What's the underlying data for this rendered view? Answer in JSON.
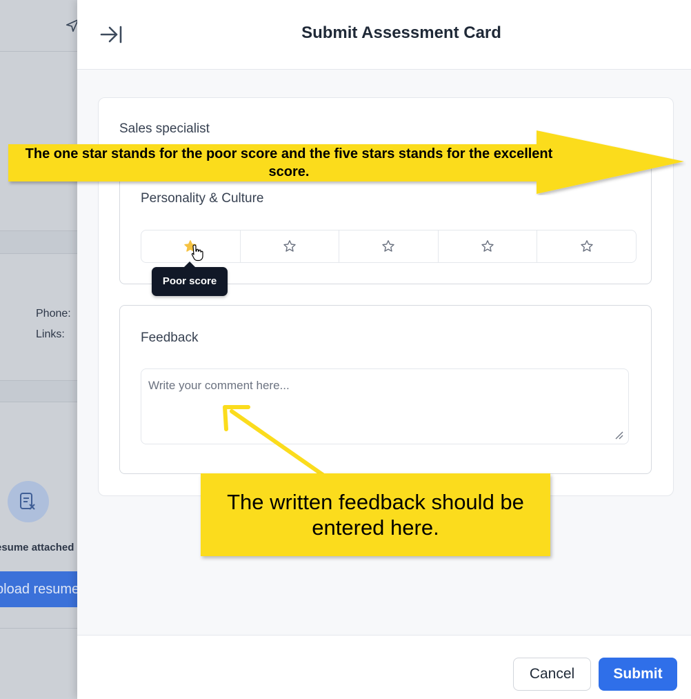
{
  "background": {
    "phone_label": "Phone:",
    "links_label": "Links:",
    "resume_text": "esume attached",
    "upload_button": "pload resume"
  },
  "drawer": {
    "title": "Submit Assessment Card",
    "job_title": "Sales specialist",
    "personality": {
      "label": "Personality & Culture",
      "rating_selected": 1,
      "rating_max": 5,
      "tooltip": "Poor score"
    },
    "feedback": {
      "label": "Feedback",
      "placeholder": "Write your comment here...",
      "value": ""
    },
    "cancel_label": "Cancel",
    "submit_label": "Submit"
  },
  "annotations": {
    "rating_note": "The one star stands for the poor score and the five stars stands for the excellent score.",
    "feedback_note": "The written feedback should be entered here."
  },
  "colors": {
    "accent": "#2f6fe9",
    "star_filled": "#f5c242",
    "star_empty": "#6b7280",
    "callout": "#fbdc1d"
  },
  "icons": {
    "collapse": "collapse-right-icon",
    "star": "star-icon",
    "send": "send-icon",
    "resume": "resume-remove-icon"
  }
}
